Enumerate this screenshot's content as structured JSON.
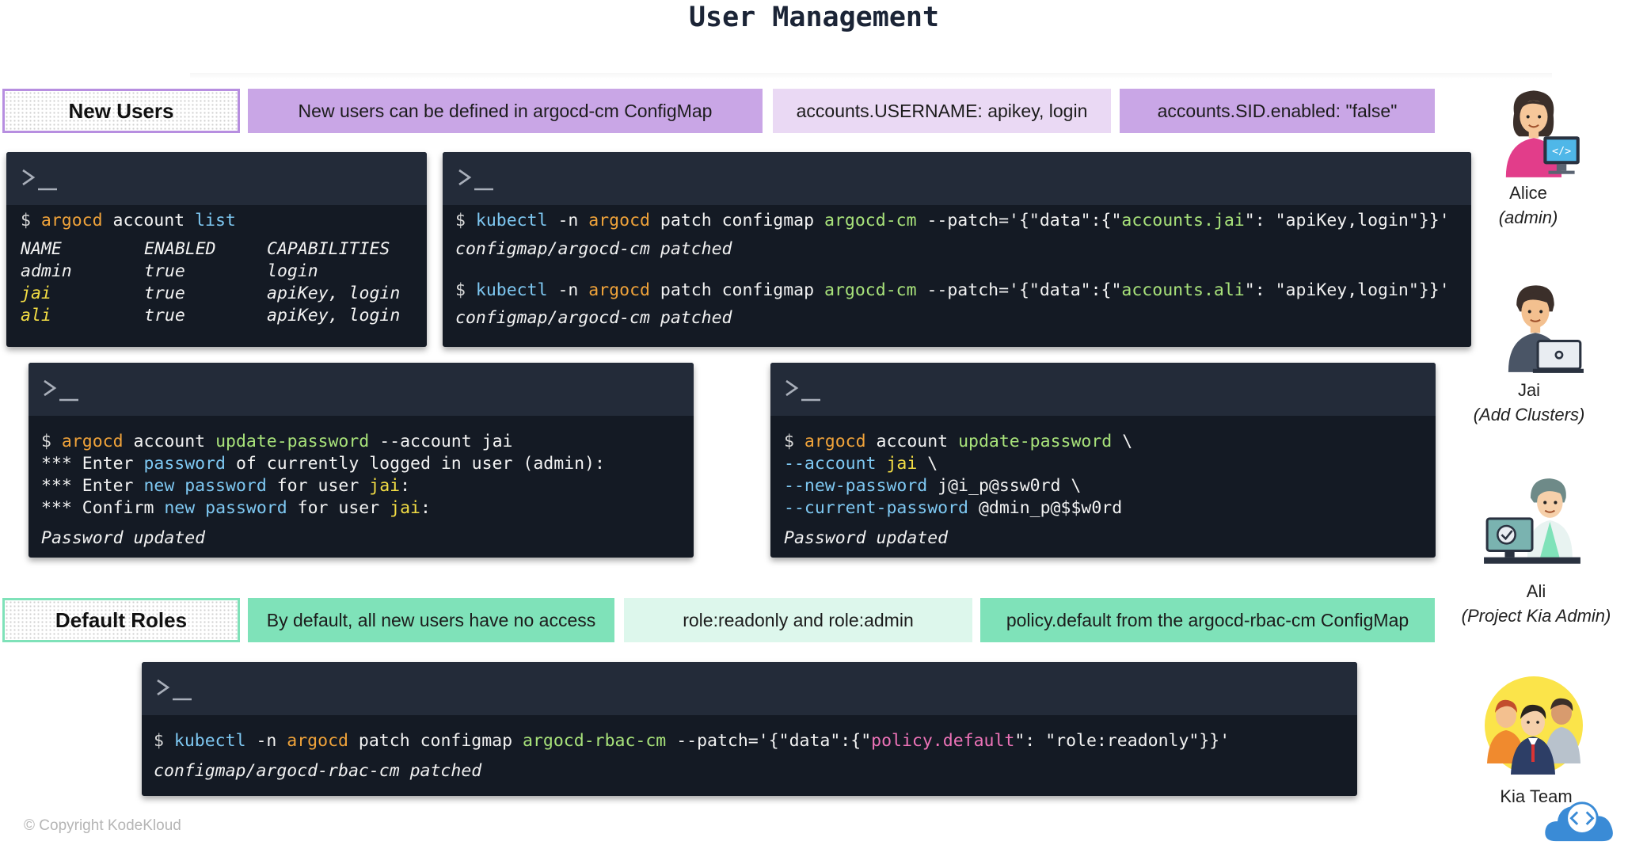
{
  "header": {
    "title": "User Management"
  },
  "new_users": {
    "label": "New Users",
    "pills": [
      "New users can be defined in argocd-cm ConfigMap",
      "accounts.USERNAME: apikey, login",
      "accounts.SID.enabled: \"false\""
    ]
  },
  "default_roles": {
    "label": "Default Roles",
    "pills": [
      "By default, all new users have no access",
      "role:readonly and role:admin",
      "policy.default from the argocd-rbac-cm ConfigMap"
    ]
  },
  "terminals": {
    "prompt_icon": "terminal-prompt-icon",
    "account_list": {
      "dollar": "$",
      "cmd_prog": "argocd",
      "cmd_rest": " account ",
      "cmd_sub": "list",
      "headers": [
        "NAME",
        "ENABLED",
        "CAPABILITIES"
      ],
      "rows": [
        [
          "admin",
          "true",
          "login"
        ],
        [
          "jai",
          "true",
          "apiKey, login"
        ],
        [
          "ali",
          "true",
          "apiKey, login"
        ]
      ]
    },
    "patch_accounts": {
      "line1": {
        "dollar": "$",
        "kubectl": "kubectl",
        "ns_flag": " -n ",
        "ns": "argocd",
        "mid": " patch configmap ",
        "cm": "argocd-cm",
        "patch_pre": " --patch='{\"data\":{\"",
        "key": "accounts.jai",
        "patch_post": "\": \"apiKey,login\"}}'"
      },
      "out1": "configmap/argocd-cm patched",
      "line2": {
        "dollar": "$",
        "kubectl": "kubectl",
        "ns_flag": " -n ",
        "ns": "argocd",
        "mid": " patch configmap ",
        "cm": "argocd-cm",
        "patch_pre": " --patch='{\"data\":{\"",
        "key": "accounts.ali",
        "patch_post": "\": \"apiKey,login\"}}'"
      },
      "out2": "configmap/argocd-cm patched"
    },
    "update_pw_interactive": {
      "dollar": "$",
      "prog": "argocd",
      "account": " account ",
      "sub": "update-password",
      "flag": " --account ",
      "user": "jai",
      "l2_a": "*** Enter ",
      "l2_b": "password",
      "l2_c": " of currently logged in user (admin):",
      "l3_a": "*** Enter ",
      "l3_b": "new password",
      "l3_c": " for user ",
      "l3_d": "jai",
      "l3_e": ":",
      "l4_a": "*** Confirm ",
      "l4_b": "new password",
      "l4_c": " for user ",
      "l4_d": "jai",
      "l4_e": ":",
      "result": "Password updated"
    },
    "update_pw_flags": {
      "dollar": "$",
      "prog": "argocd",
      "account": " account ",
      "sub": "update-password",
      "cont1": " \\",
      "flag_account": "--account",
      "user": "jai",
      "cont2": " \\",
      "flag_new": "--new-password",
      "new_value": " j@i_p@ssw0rd \\",
      "flag_current": "--current-password",
      "current_value": " @dmin_p@$$w0rd",
      "result": "Password updated"
    },
    "rbac_patch": {
      "dollar": "$",
      "kubectl": "kubectl",
      "ns_flag": " -n ",
      "ns": "argocd",
      "mid": " patch configmap ",
      "cm": "argocd-rbac-cm",
      "patch_pre": " --patch='{\"data\":{\"",
      "key": "policy.default",
      "patch_post": "\": \"role:readonly\"}}'",
      "out": "configmap/argocd-rbac-cm patched"
    }
  },
  "people": [
    {
      "name": "Alice",
      "role": "(admin)",
      "icon": "developer-avatar-icon"
    },
    {
      "name": "Jai",
      "role": "(Add Clusters)",
      "icon": "laptop-user-icon"
    },
    {
      "name": "Ali",
      "role": "(Project Kia Admin)",
      "icon": "admin-workstation-icon"
    },
    {
      "name": "Kia Team",
      "role": "",
      "icon": "team-group-icon"
    }
  ],
  "footer": {
    "copyright": "© Copyright KodeKloud",
    "logo_icon": "code-cloud-logo-icon"
  },
  "colors": {
    "pill_purple": "#c9a6e6",
    "pill_purple_light": "#ead9f4",
    "pill_green": "#7fe2b9",
    "pill_green_light": "#ddf7ec",
    "label_border_purple": "#b78ee0",
    "label_border_green": "#7fe2b9",
    "terminal_bg": "#141a24",
    "terminal_header": "#232b39"
  }
}
